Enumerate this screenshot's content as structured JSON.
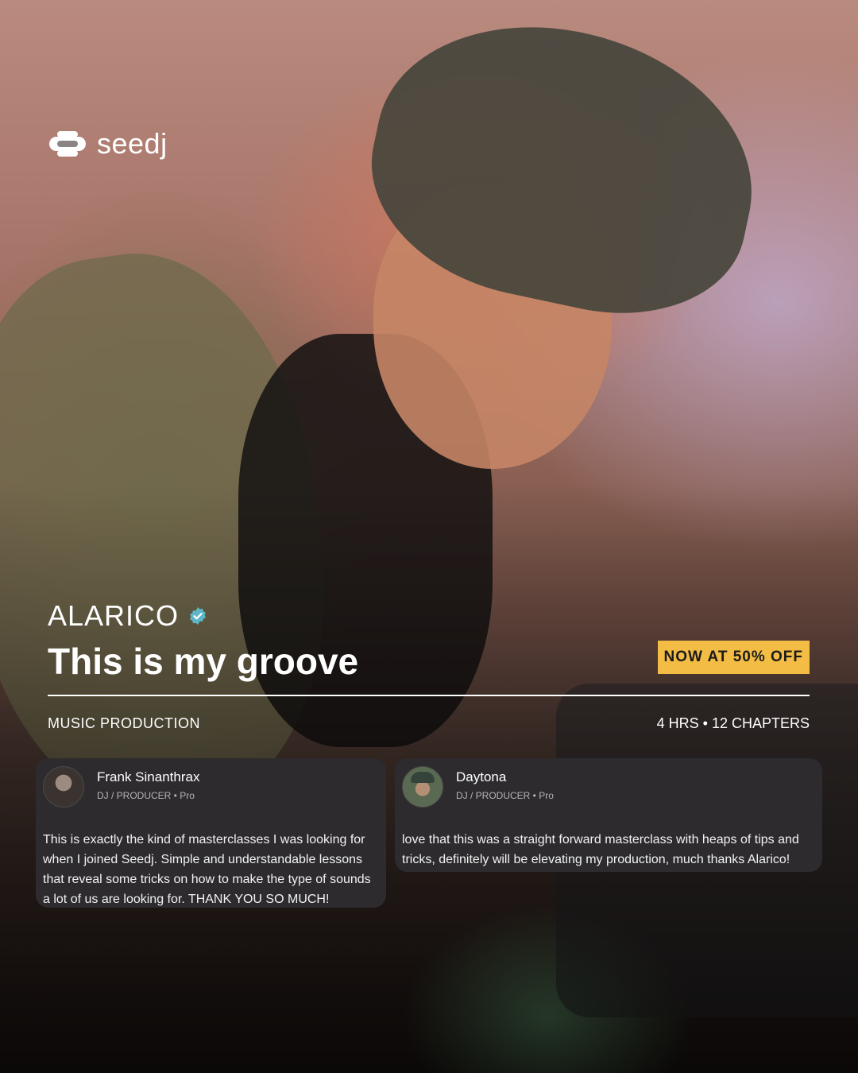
{
  "brand": {
    "name": "seedj",
    "icon": "seedj-logo-icon"
  },
  "course": {
    "artist": "ALARICO",
    "verified_icon": "verified-badge-icon",
    "title": "This is my groove",
    "category": "MUSIC PRODUCTION",
    "meta": "4 HRS • 12 CHAPTERS",
    "discount": "NOW AT 50% OFF"
  },
  "colors": {
    "badge": "#f3bd45",
    "card": "#2d2b2e",
    "verified": "#5fb6c9"
  },
  "reviews": [
    {
      "name": "Frank Sinanthrax",
      "role": "DJ / PRODUCER • Pro",
      "text": "This is exactly the kind of masterclasses I was looking for when I joined Seedj. Simple and understandable lessons that reveal some tricks on how to make the type of sounds a lot of us are looking for. THANK YOU SO MUCH!"
    },
    {
      "name": "Daytona",
      "role": "DJ / PRODUCER • Pro",
      "text": "love that this was a straight forward masterclass with heaps of tips and tricks, definitely will be elevating my production, much thanks Alarico!"
    }
  ]
}
